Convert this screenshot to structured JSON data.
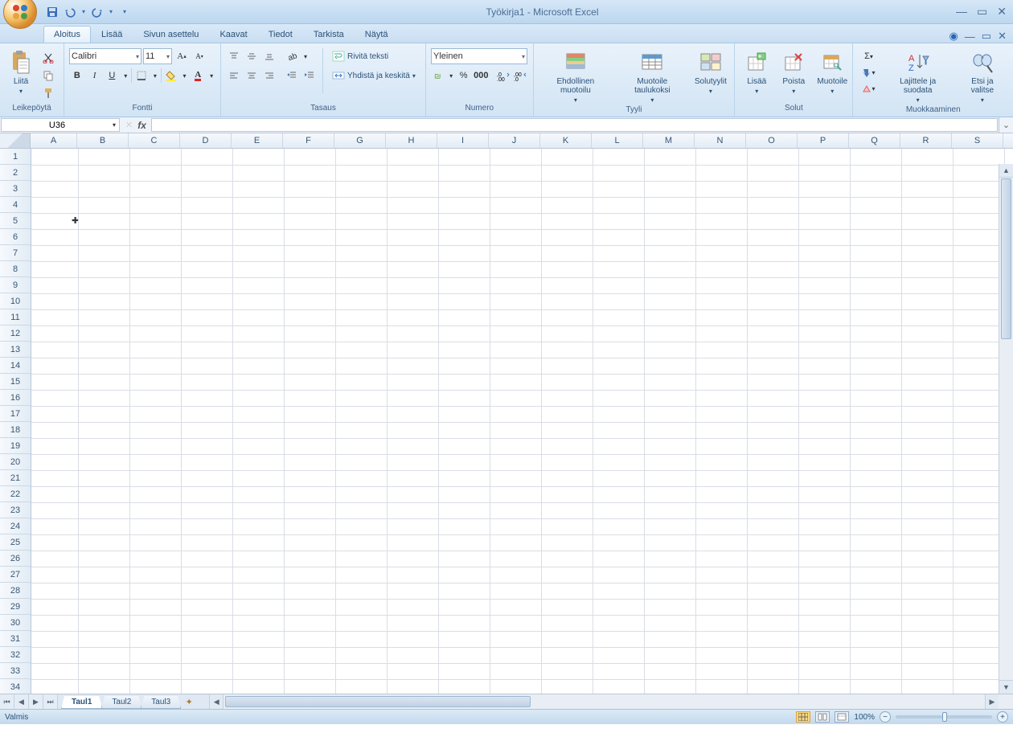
{
  "title": "Työkirja1 - Microsoft Excel",
  "tabs": [
    "Aloitus",
    "Lisää",
    "Sivun asettelu",
    "Kaavat",
    "Tiedot",
    "Tarkista",
    "Näytä"
  ],
  "active_tab": 0,
  "qat": {
    "save": "save",
    "undo": "undo",
    "redo": "redo"
  },
  "ribbon": {
    "clipboard": {
      "label": "Leikepöytä",
      "paste": "Liitä"
    },
    "font": {
      "label": "Fontti",
      "name": "Calibri",
      "size": "11",
      "bold": "B",
      "italic": "I",
      "underline": "U"
    },
    "alignment": {
      "label": "Tasaus",
      "wrap": "Rivitä teksti",
      "merge": "Yhdistä ja keskitä"
    },
    "number": {
      "label": "Numero",
      "format": "Yleinen"
    },
    "styles": {
      "label": "Tyyli",
      "conditional": "Ehdollinen muotoilu",
      "astable": "Muotoile taulukoksi",
      "cellstyles": "Solutyylit"
    },
    "cells": {
      "label": "Solut",
      "insert": "Lisää",
      "delete": "Poista",
      "format": "Muotoile"
    },
    "editing": {
      "label": "Muokkaaminen",
      "sort": "Lajittele ja suodata",
      "find": "Etsi ja valitse"
    }
  },
  "namebox": "U36",
  "columns": [
    "A",
    "B",
    "C",
    "D",
    "E",
    "F",
    "G",
    "H",
    "I",
    "J",
    "K",
    "L",
    "M",
    "N",
    "O",
    "P",
    "Q",
    "R",
    "S"
  ],
  "rows": [
    "1",
    "2",
    "3",
    "4",
    "5",
    "6",
    "7",
    "8",
    "9",
    "10",
    "11",
    "12",
    "13",
    "14",
    "15",
    "16",
    "17",
    "18",
    "19",
    "20",
    "21",
    "22",
    "23",
    "24",
    "25",
    "26",
    "27",
    "28",
    "29",
    "30",
    "31",
    "32",
    "33",
    "34"
  ],
  "sheets": [
    "Taul1",
    "Taul2",
    "Taul3"
  ],
  "active_sheet": 0,
  "status": "Valmis",
  "zoom": "100%"
}
